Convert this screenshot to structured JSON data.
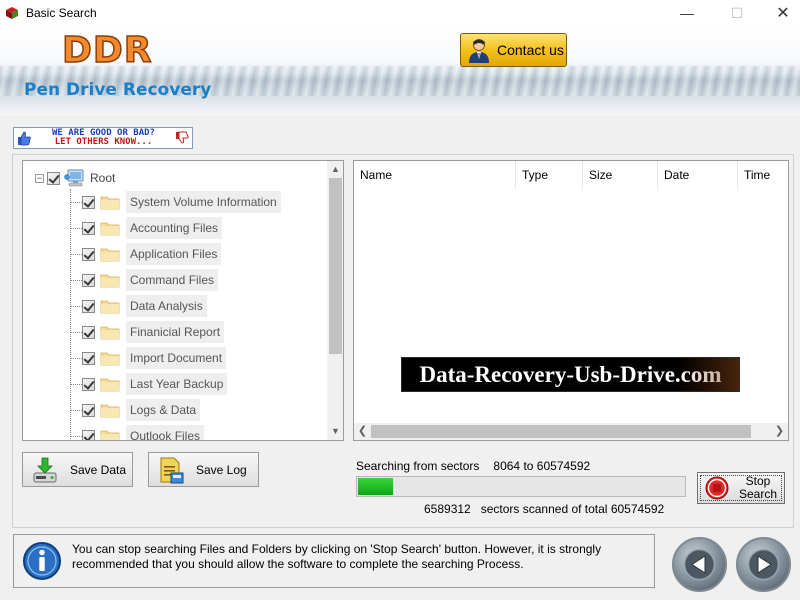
{
  "window": {
    "title": "Basic Search",
    "controls": {
      "minimize": "—",
      "maximize": "☐",
      "close": "✕"
    }
  },
  "header": {
    "logo": "DDR",
    "product_name": "Pen Drive Recovery",
    "contact_button": "Contact us"
  },
  "rate_banner": {
    "line1": "WE ARE GOOD OR BAD?",
    "line2": "LET OTHERS KNOW..."
  },
  "tree": {
    "root_label": "Root",
    "items": [
      "System Volume Information",
      "Accounting Files",
      "Application Files",
      "Command Files",
      "Data Analysis",
      "Finanicial Report",
      "Import Document",
      "Last Year Backup",
      "Logs & Data",
      "Outlook Files"
    ],
    "scroll_up": "▲",
    "scroll_down": "▼"
  },
  "list": {
    "columns": [
      "Name",
      "Type",
      "Size",
      "Date",
      "Time"
    ],
    "watermark": "Data-Recovery-Usb-Drive.com",
    "scroll_left": "❮",
    "scroll_right": "❯"
  },
  "actions": {
    "save_data": "Save Data",
    "save_log": "Save Log"
  },
  "progress": {
    "label": "Searching from sectors",
    "from_sector": "8064",
    "to_label": "to",
    "to_sector": "60574592",
    "fraction": 0.1088,
    "scanned": "6589312",
    "scanned_text": "sectors scanned of total",
    "total": "60574592",
    "fill_color": "#1fba1f"
  },
  "stop_button": {
    "line1": "Stop",
    "line2": "Search"
  },
  "info": {
    "message": "You can stop searching Files and Folders by clicking on 'Stop Search' button. However, it is strongly recommended that you should allow the software to complete the searching Process."
  },
  "icons": {
    "app": "app-logo-icon",
    "contact": "person-avatar-icon",
    "thumb_up": "thumb-up-icon",
    "thumb_down": "thumb-down-icon",
    "root": "computer-icon",
    "folder": "folder-icon",
    "save_data": "save-drive-icon",
    "save_log": "log-document-icon",
    "stop": "stop-icon",
    "info": "info-icon",
    "back": "back-arrow-icon",
    "next": "next-arrow-icon"
  }
}
